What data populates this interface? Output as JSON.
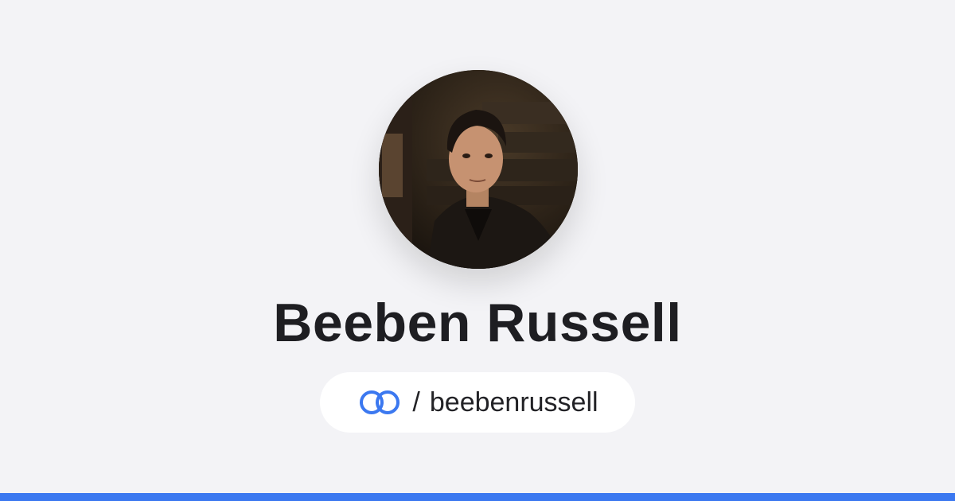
{
  "profile": {
    "name": "Beeben Russell",
    "separator": "/",
    "username": "beebenrussell",
    "avatar_alt": "profile-photo"
  },
  "icons": {
    "logo": "linked-rings-icon"
  },
  "colors": {
    "background": "#f3f3f6",
    "accent": "#3b78f0",
    "text": "#1e1e22",
    "pill": "#ffffff"
  }
}
